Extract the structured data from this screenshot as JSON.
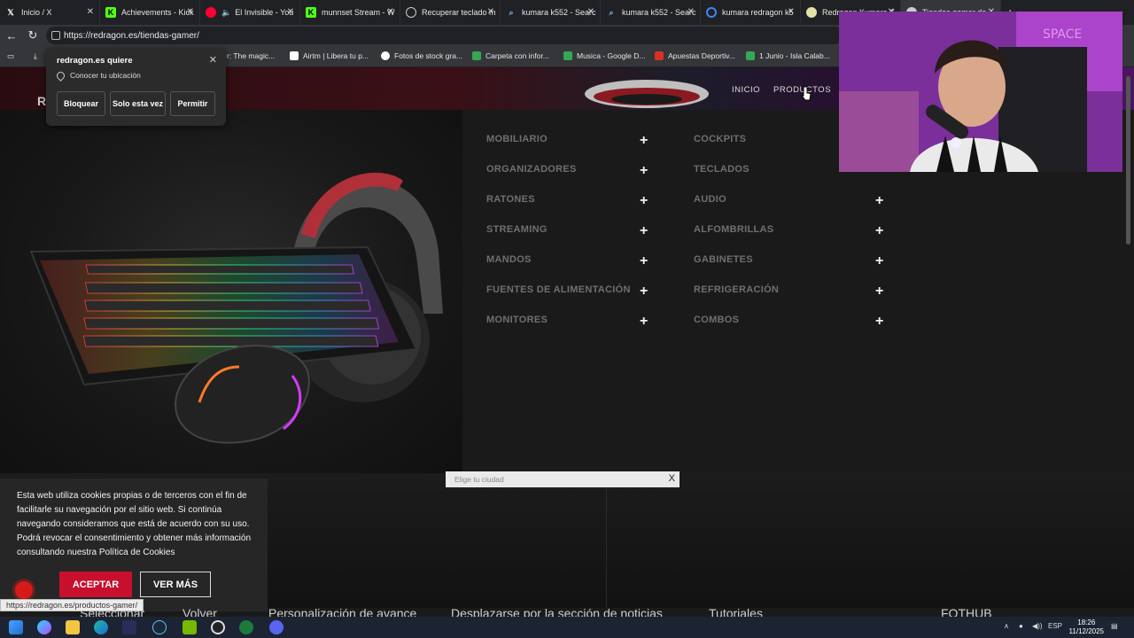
{
  "tabs": [
    {
      "title": "Inicio / X",
      "icon": "x-logo-icon",
      "color": "#ffffff"
    },
    {
      "title": "Achievements - Kick",
      "icon": "kick-logo-icon",
      "color": "#53fc18"
    },
    {
      "title": "El Invisible - You",
      "icon": "youtube-icon",
      "color": "#ff0033"
    },
    {
      "title": "munnset Stream - W",
      "icon": "kick-logo-icon",
      "color": "#53fc18"
    },
    {
      "title": "Recuperar teclado m",
      "icon": "globe-icon",
      "color": "#cccccc"
    },
    {
      "title": "kumara k552 - Searc",
      "icon": "search-icon",
      "color": "#8ab4f8"
    },
    {
      "title": "kumara k552 - Searc",
      "icon": "search-icon",
      "color": "#8ab4f8"
    },
    {
      "title": "kumara redragon k5",
      "icon": "google-icon",
      "color": "#ffffff"
    },
    {
      "title": "Redragon Kumara K",
      "icon": "redragon-icon",
      "color": "#e2e2a8"
    },
    {
      "title": "Tiendas gamer de",
      "icon": "redragon-icon",
      "color": "#cccccc"
    }
  ],
  "address": {
    "url": "https://redragon.es/tiendas-gamer/"
  },
  "bookmarks": [
    {
      "label": "r: The magic...",
      "color": "#666666"
    },
    {
      "label": "Airtm | Libera tu p...",
      "color": "#ffffff"
    },
    {
      "label": "Fotos de stock gra...",
      "color": "#ffffff"
    },
    {
      "label": "Carpeta con infor...",
      "color": "#34a853"
    },
    {
      "label": "Musica - Google D...",
      "color": "#34a853"
    },
    {
      "label": "Apuestas Deportiv...",
      "color": "#d93025"
    },
    {
      "label": "1 Junio - Isla Calab...",
      "color": "#34a853"
    }
  ],
  "permission": {
    "title": "redragon.es quiere",
    "location_text": "Conocer tu ubicación",
    "block": "Bloquear",
    "once": "Solo esta vez",
    "allow": "Permitir"
  },
  "site": {
    "logo_letter": "R",
    "nav_inicio": "INICIO",
    "nav_productos": "PRODUCTOS",
    "categories_left": [
      "MOBILIARIO",
      "ORGANIZADORES",
      "RATONES",
      "STREAMING",
      "MANDOS",
      "FUENTES DE ALIMENTACIÓN",
      "MONITORES"
    ],
    "categories_right": [
      "COCKPITS",
      "TECLADOS",
      "AUDIO",
      "ALFOMBRILLAS",
      "GABINETES",
      "REFRIGERACIÓN",
      "COMBOS"
    ],
    "plus": "+",
    "city_placeholder": "Elige tu ciudad",
    "city_close": "X"
  },
  "cookie": {
    "text": "Esta web utiliza cookies propias o de terceros con el fin de facilitarle su navegación por el sitio web. Si continúa navegando consideramos que está de acuerdo con su uso. Podrá revocar el consentimiento y obtener más información consultando nuestra Política de Cookies",
    "accept": "ACEPTAR",
    "more": "VER MÁS"
  },
  "status_url": "https://redragon.es/productos-gamer/",
  "behind": {
    "t1": "Seleccionar",
    "t2": "Volver",
    "t3": "Personalización de avance",
    "t4": "Desplazarse por la sección de noticias",
    "t5": "Tutoriales",
    "t6": "FOTHUB"
  },
  "taskbar": {
    "lang": "ESP",
    "time": "18:26",
    "date": "11/12/2025"
  },
  "colors": {
    "accent_red": "#c8102e",
    "menu_text": "#6f6f6f"
  }
}
